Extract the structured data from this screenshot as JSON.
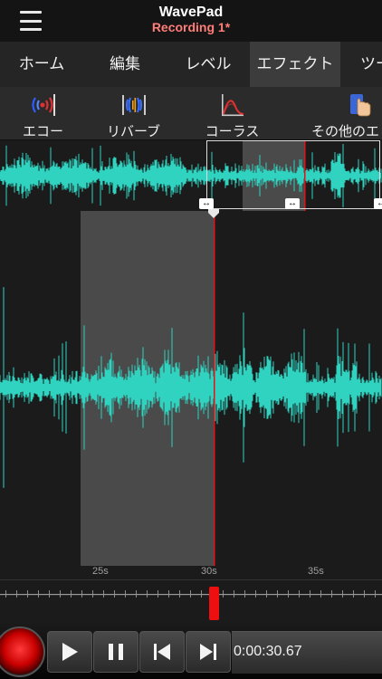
{
  "header": {
    "app_title": "WavePad",
    "document_title": "Recording 1*"
  },
  "tabs": [
    {
      "label": "ホーム",
      "active": false
    },
    {
      "label": "編集",
      "active": false
    },
    {
      "label": "レベル",
      "active": false
    },
    {
      "label": "エフェクト",
      "active": true
    },
    {
      "label": "ツー",
      "active": false
    }
  ],
  "effects": [
    {
      "label": "エコー",
      "icon": "echo-icon"
    },
    {
      "label": "リバーブ",
      "icon": "reverb-icon"
    },
    {
      "label": "コーラス",
      "icon": "chorus-icon"
    },
    {
      "label": "その他のエ",
      "icon": "more-effects-icon"
    }
  ],
  "timeline": {
    "labels": [
      "25s",
      "30s",
      "35s"
    ]
  },
  "transport": {
    "time": "0:00:30.67"
  },
  "colors": {
    "waveform": "#2fd3c0",
    "playhead": "#e0141c",
    "accent_title": "#ff7e78"
  }
}
